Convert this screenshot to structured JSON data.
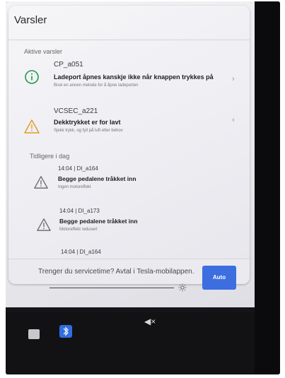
{
  "window": {
    "title": "Varsler"
  },
  "sections": {
    "active": "Aktive varsler",
    "earlier": "Tidligere i dag"
  },
  "active_alerts": [
    {
      "code": "CP_a051",
      "title": "Ladeport åpnes kanskje ikke når knappen trykkes på",
      "subtitle": "Bruk en annen metode for å åpne ladeporten",
      "icon": "info-circle-icon"
    },
    {
      "code": "VCSEC_a221",
      "title": "Dekktrykket er for lavt",
      "subtitle": "Sjekk trykk, og fyll på luft etter behov",
      "icon": "warning-triangle-icon"
    }
  ],
  "earlier_alerts": [
    {
      "code": "14:04 | DI_a164",
      "title": "Begge pedalene tråkket inn",
      "subtitle": "Ingen motoreffekt",
      "icon": "warning-triangle-icon"
    },
    {
      "code": "14:04 | DI_a173",
      "title": "Begge pedalene tråkket inn",
      "subtitle": "Motoreffekt redusert",
      "icon": "warning-triangle-icon"
    },
    {
      "code": "14:04 | DI_a164",
      "icon": "warning-triangle-icon"
    }
  ],
  "service": {
    "text": "Trenger du servicetime? Avtal i Tesla-mobilappen."
  },
  "controls": {
    "auto_label": "Auto",
    "brightness_icon": "sun-icon"
  },
  "taskbar": {
    "mute_label": "◀×",
    "icons": [
      "app-icon",
      "bluetooth-icon",
      "mute-icon"
    ]
  },
  "colors": {
    "info_green": "#1e9a4a",
    "warning_orange": "#e39a2a",
    "auto_blue": "#3d6ee0"
  }
}
